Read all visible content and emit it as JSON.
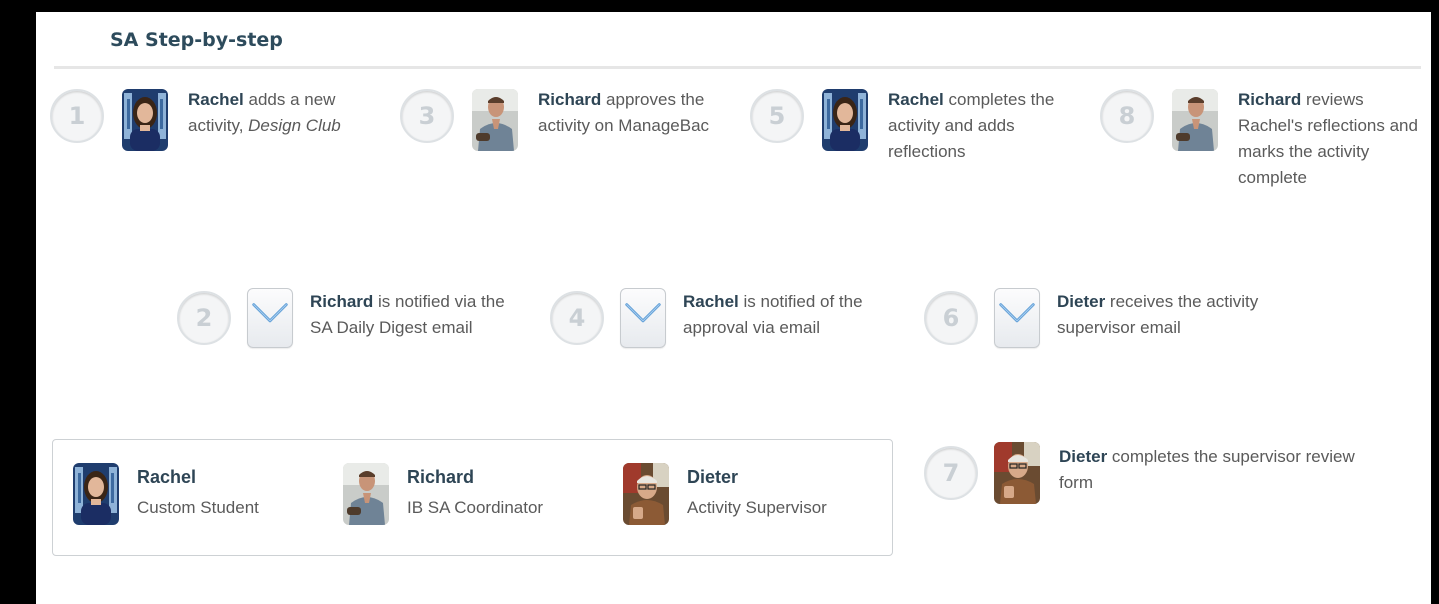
{
  "title": "SA Step-by-step",
  "people": {
    "rachel": {
      "name": "Rachel",
      "role": "Custom Student"
    },
    "richard": {
      "name": "Richard",
      "role": "IB SA Coordinator"
    },
    "dieter": {
      "name": "Dieter",
      "role": "Activity Supervisor"
    }
  },
  "steps": [
    {
      "number": "1",
      "actor": "Rachel",
      "text": "adds a new activity,",
      "emphasis": "Design Club"
    },
    {
      "number": "3",
      "actor": "Richard",
      "text": "approves the activity on ManageBac"
    },
    {
      "number": "5",
      "actor": "Rachel",
      "text": "completes the activity and adds reflections"
    },
    {
      "number": "8",
      "actor": "Richard",
      "text": "reviews Rachel's reflections and marks the activity complete"
    },
    {
      "number": "2",
      "actor": "Richard",
      "text": "is notified via the SA Daily Digest email"
    },
    {
      "number": "4",
      "actor": "Rachel",
      "text": "is notified of the approval via email"
    },
    {
      "number": "6",
      "actor": "Dieter",
      "text": "receives the activity supervisor email"
    },
    {
      "number": "7",
      "actor": "Dieter",
      "text": "completes the supervisor review form"
    }
  ],
  "colors": {
    "heading": "#2d4b5c",
    "body_text": "#5a5a5a",
    "circle_number": "#c9cfd4"
  },
  "icons": {
    "email": "envelope-icon"
  }
}
